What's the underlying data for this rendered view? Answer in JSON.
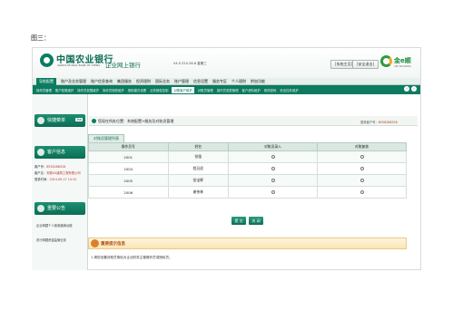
{
  "caption": "图三：",
  "header": {
    "bank_name": "中国农业银行",
    "bank_en": "AGRICULTURAL BANK OF CHINA",
    "system_title": "企业网上银行",
    "system_sub": "V4.0  Z10-26-6 星期三",
    "home_button": "[系统主页]",
    "exit_button": "[安全退出]",
    "brand": "金e顺",
    "brand_sub": "ABC EBANKING"
  },
  "nav": {
    "main": [
      "导航配置",
      "账户及业务管理",
      "账户信息查询",
      "集团服务",
      "投资理财",
      "国际业务",
      "账户管理",
      "信息设置",
      "服务专区",
      "个人理财",
      "附加功能"
    ],
    "main_active_index": 0,
    "sub": [
      "操作员管理",
      "账户权限维护",
      "操作员权限维护",
      "操作员授权维护",
      "授权模式设置",
      "业务授权控制",
      "对账客户维护",
      "对账员管理",
      "操作员变更管理",
      "客户资料维护",
      "修改密码",
      "安全控件维护"
    ],
    "sub_active_index": 6
  },
  "sidebar": {
    "quick_menu_label": "快捷菜单",
    "quick_menu_tag": "Tab",
    "customer_info_label": "客户信息",
    "customer_no_label": "客户号：",
    "customer_no": "6558286528",
    "customer_name_label": "客户名：",
    "customer_name": "安徽XX建筑工程有限公司",
    "login_time_label": "登录时间：",
    "login_time": "2014-09-17 14:15",
    "notice_label": "重要公告",
    "links": [
      "企业网银个人费用缴纳功能",
      "农行网银资金监管业务"
    ]
  },
  "content": {
    "breadcrumb": "您现在所处位置：系统配置>服务及对账员管理",
    "login_no_label": "登录客户号：",
    "login_no": "6558286528",
    "tab_label": "对账员管理列表",
    "table": {
      "headers": [
        "操作员号",
        "姓名",
        "对账员录入",
        "对账复核"
      ],
      "rows": [
        {
          "op_no": "2001",
          "name": "张强"
        },
        {
          "op_no": "2004",
          "name": "程吕虎"
        },
        {
          "op_no": "2005",
          "name": "张宝辉"
        },
        {
          "op_no": "2006",
          "name": "谢伟林"
        }
      ]
    },
    "confirm_button": "提 交",
    "reset_button": "关 闭",
    "tip_title": "重要提示信息",
    "tip_text": "1.请您设置对账员角色为企业财务主管操作员或授权员。"
  },
  "colors": {
    "brand_green": "#0b7d62",
    "tip_orange": "#d9822b",
    "value_red": "#c0392b"
  }
}
